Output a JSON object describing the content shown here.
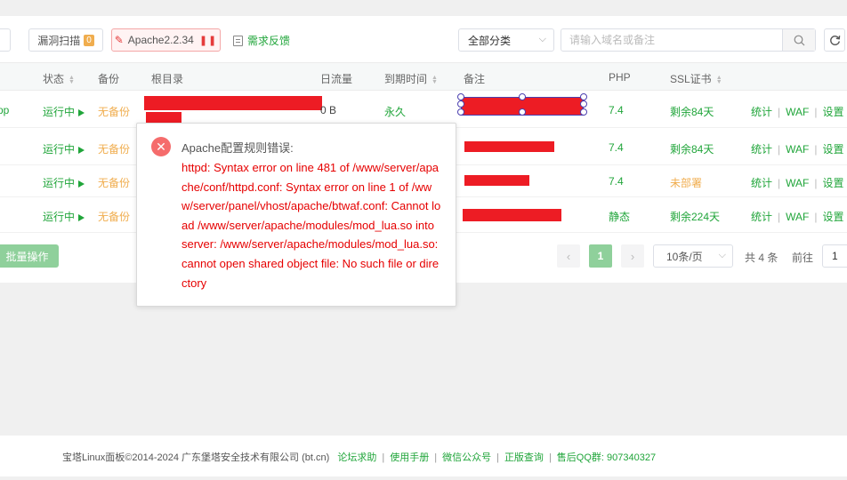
{
  "toolbar": {
    "vuln_scan_label": "漏洞扫描",
    "vuln_scan_count": "0",
    "apache_label": "Apache2.2.34",
    "feedback_label": "需求反馈",
    "category_value": "全部分类",
    "search_placeholder": "请输入域名或备注"
  },
  "table": {
    "headers": {
      "status": "状态",
      "backup": "备份",
      "root": "根目录",
      "traffic": "日流量",
      "expiry": "到期时间",
      "remark": "备注",
      "php": "PHP",
      "ssl": "SSL证书"
    },
    "rows": [
      {
        "name_fragment": "pp",
        "status": "运行中",
        "backup": "无备份",
        "traffic": "0 B",
        "expiry": "永久",
        "php": "7.4",
        "ssl": "剩余84天",
        "ssl_color": "#20a53a"
      },
      {
        "name_fragment": "",
        "status": "运行中",
        "backup": "无备份",
        "traffic": "",
        "expiry": "",
        "php": "7.4",
        "ssl": "剩余84天",
        "ssl_color": "#20a53a"
      },
      {
        "name_fragment": "",
        "status": "运行中",
        "backup": "无备份",
        "traffic": "",
        "expiry": "",
        "php": "7.4",
        "ssl": "未部署",
        "ssl_color": "#f0ad4e"
      },
      {
        "name_fragment": "",
        "status": "运行中",
        "backup": "无备份",
        "traffic": "",
        "expiry": "",
        "php": "静态",
        "ssl": "剩余224天",
        "ssl_color": "#20a53a"
      }
    ],
    "actions": {
      "stats": "统计",
      "waf": "WAF",
      "settings": "设置"
    }
  },
  "batch_label": "批量操作",
  "pagination": {
    "prev": "‹",
    "current": "1",
    "next": "›",
    "page_size": "10条/页",
    "total": "共 4 条",
    "goto_label": "前往",
    "goto_value": "1"
  },
  "dialog": {
    "title": "Apache配置规则错误:",
    "message": "httpd: Syntax error on line 481 of /www/server/apache/conf/httpd.conf: Syntax error on line 1 of /www/server/panel/vhost/apache/btwaf.conf: Cannot load /www/server/apache/modules/mod_lua.so into server: /www/server/apache/modules/mod_lua.so: cannot open shared object file: No such file or directory"
  },
  "footer": {
    "copyright": "宝塔Linux面板©2014-2024 广东堡塔安全技术有限公司 (bt.cn)",
    "links": [
      "论坛求助",
      "使用手册",
      "微信公众号",
      "正版查询"
    ],
    "qq_label": "售后QQ群: 907340327"
  },
  "colors": {
    "accent": "#20a53a",
    "warning": "#f0ad4e",
    "error": "#e60000",
    "redaction": "#ed1c24"
  }
}
